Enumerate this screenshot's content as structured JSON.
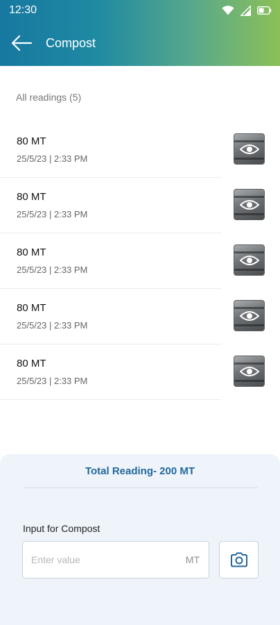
{
  "status_bar": {
    "time": "12:30",
    "icons": [
      "wifi-icon",
      "cellular-signal-icon",
      "battery-icon"
    ]
  },
  "app_bar": {
    "title": "Compost",
    "back_icon": "arrow-left-icon",
    "gradient_colors": [
      "#1778a0",
      "#8cc056"
    ]
  },
  "readings": {
    "header": "All readings (5)",
    "items": [
      {
        "value": "80 MT",
        "timestamp": "25/5/23 | 2:33 PM",
        "icon": "eye-icon"
      },
      {
        "value": "80 MT",
        "timestamp": "25/5/23 | 2:33 PM",
        "icon": "eye-icon"
      },
      {
        "value": "80 MT",
        "timestamp": "25/5/23 | 2:33 PM",
        "icon": "eye-icon"
      },
      {
        "value": "80 MT",
        "timestamp": "25/5/23 | 2:33 PM",
        "icon": "eye-icon"
      },
      {
        "value": "80 MT",
        "timestamp": "25/5/23 | 2:33 PM",
        "icon": "eye-icon"
      }
    ]
  },
  "bottom_panel": {
    "total": "Total Reading- 200 MT",
    "input_label": "Input for Compost",
    "input_placeholder": "Enter value",
    "input_value": "",
    "unit": "MT",
    "camera_icon": "camera-icon",
    "accent_color": "#22679c"
  }
}
